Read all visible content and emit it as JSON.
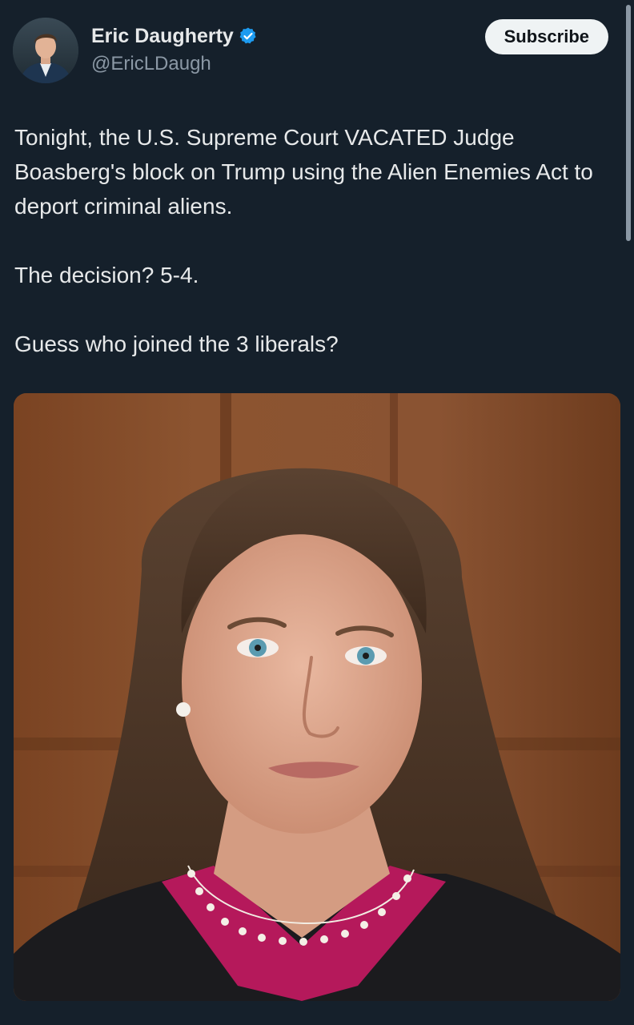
{
  "post": {
    "author": {
      "display_name": "Eric Daugherty",
      "handle": "@EricLDaugh",
      "verified": true,
      "verified_color": "#1d9bf0"
    },
    "subscribe_label": "Subscribe",
    "text_paragraphs": [
      "Tonight, the U.S. Supreme Court VACATED Judge Boasberg's block on Trump using the Alien Enemies Act to deport criminal aliens.",
      "The decision? 5-4.",
      "Guess who joined the 3 liberals?"
    ],
    "media": {
      "type": "photo",
      "icon": "photo-portrait"
    }
  },
  "theme": {
    "background": "#15202b",
    "text_primary": "#e7e9ea",
    "text_secondary": "#8b98a5",
    "button_bg": "#eff3f4"
  }
}
